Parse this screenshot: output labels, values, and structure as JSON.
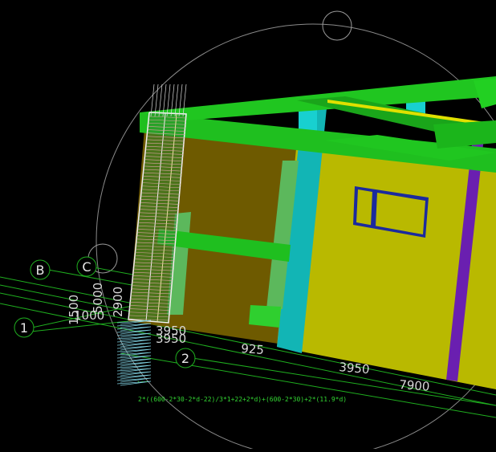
{
  "viewport": {
    "background": "#000000",
    "colors": {
      "grid_line": "#1fae1f",
      "beam_green": "#1fbf1f",
      "beam_green_dark": "#159a15",
      "wall_yellow": "#b9b900",
      "wall_olive": "#6e5a00",
      "column_cyan": "#12b5b5",
      "column_purple": "#6a1fb0",
      "window_blue": "#1b2a9e",
      "rebar_white": "#f0f0f0",
      "orbit_circle": "#9a9a9a"
    }
  },
  "grid_markers": {
    "b": "B",
    "c": "C",
    "one": "1",
    "two": "2"
  },
  "dimensions": {
    "d1500": "1500",
    "d5000": "5000",
    "d1000": "1000",
    "d2900": "2900",
    "d3950_top": "3950",
    "d3950_left": "3950",
    "d925": "925",
    "d3950_right": "3950",
    "d7900": "7900"
  },
  "annotations": {
    "rebar_formula": "2*((600-2*30-2*d-22)/3*1+22+2*d)+(600-2*30)+2*(11.9*d)",
    "small_tag": "..."
  }
}
